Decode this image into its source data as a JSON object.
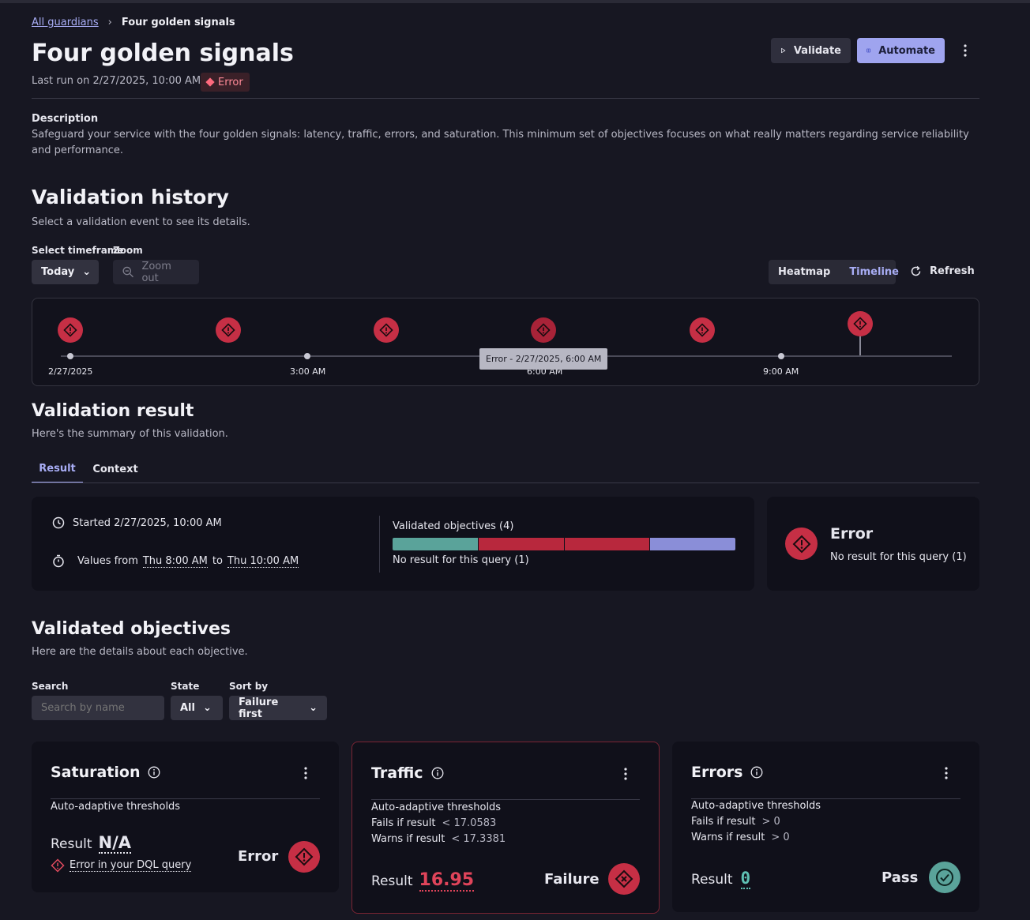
{
  "breadcrumb": {
    "parent": "All guardians",
    "current": "Four golden signals"
  },
  "header": {
    "title": "Four golden signals",
    "last_run": "Last run on 2/27/2025, 10:00 AM",
    "status": "Error",
    "validate_label": "Validate",
    "automate_label": "Automate"
  },
  "description": {
    "label": "Description",
    "text": "Safeguard your service with the four golden signals: latency, traffic, errors, and saturation. This minimum set of objectives focuses on what really matters regarding service reliability and performance."
  },
  "history": {
    "title": "Validation history",
    "subtitle": "Select a validation event to see its details.",
    "timeframe_label": "Select timeframe",
    "timeframe_value": "Today",
    "zoom_label": "Zoom",
    "zoom_out": "Zoom out",
    "view_heatmap": "Heatmap",
    "view_timeline": "Timeline",
    "refresh": "Refresh",
    "ticks": [
      "2/27/2025",
      "3:00 AM",
      "6:00 AM",
      "9:00 AM"
    ],
    "tooltip": "Error - 2/27/2025, 6:00 AM"
  },
  "result": {
    "title": "Validation result",
    "subtitle": "Here's the summary of this validation.",
    "tab_result": "Result",
    "tab_context": "Context",
    "started": "Started 2/27/2025, 10:00 AM",
    "values_prefix": "Values from",
    "values_from": "Thu 8:00 AM",
    "values_to_word": "to",
    "values_to": "Thu 10:00 AM",
    "objectives_label": "Validated objectives (4)",
    "no_result": "No result for this query (1)",
    "bar_segments": [
      {
        "color": "#5aa39a",
        "fraction": 0.25
      },
      {
        "color": "#b8283d",
        "fraction": 0.25
      },
      {
        "color": "#b8283d",
        "fraction": 0.25
      },
      {
        "color": "#8a8ed8",
        "fraction": 0.25
      }
    ],
    "summary_status": "Error",
    "summary_detail": "No result for this query (1)"
  },
  "objectives": {
    "title": "Validated objectives",
    "subtitle": "Here are the details about each objective.",
    "search_label": "Search",
    "search_placeholder": "Search by name",
    "state_label": "State",
    "state_value": "All",
    "sort_label": "Sort by",
    "sort_value": "Failure first",
    "cards": [
      {
        "name": "Saturation",
        "mode": "Auto-adaptive thresholds",
        "result_label": "Result",
        "result_value": "N/A",
        "error_link": "Error in your DQL query",
        "status": "Error"
      },
      {
        "name": "Traffic",
        "mode": "Auto-adaptive thresholds",
        "fails": "Fails if result",
        "fails_value": "< 17.0583",
        "warns": "Warns if result",
        "warns_value": "< 17.3381",
        "result_label": "Result",
        "result_value": "16.95",
        "status": "Failure"
      },
      {
        "name": "Errors",
        "mode": "Auto-adaptive thresholds",
        "fails": "Fails if result",
        "fails_value": "> 0",
        "warns": "Warns if result",
        "warns_value": "> 0",
        "result_label": "Result",
        "result_value": "0",
        "status": "Pass"
      }
    ]
  }
}
